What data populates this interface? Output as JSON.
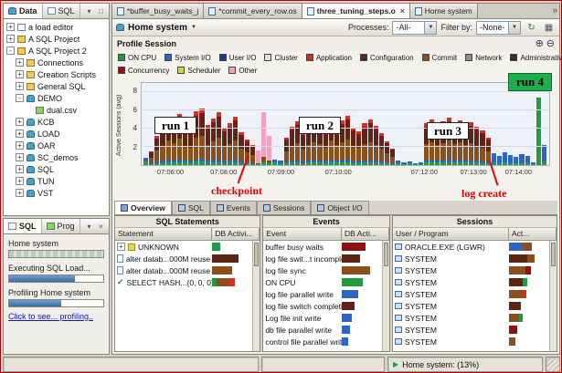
{
  "colors": {
    "cpu": "#1e9c40",
    "sysio": "#2e64c8",
    "usrio": "#123c96",
    "cluster": "#e8e0d0",
    "app": "#cc3322",
    "config": "#5e2414",
    "commit": "#8a4f1d",
    "net": "#8c8c8c",
    "admin": "#303030",
    "conc": "#8d1111",
    "sched": "#ccd444",
    "other": "#f2a0bc"
  },
  "explorer": {
    "tabs": [
      {
        "label": "Data",
        "active": true
      },
      {
        "label": "SQL",
        "active": false
      }
    ],
    "tree": [
      {
        "label": "a load editor",
        "indent": 0,
        "exp": "+",
        "icon": "doc"
      },
      {
        "label": "A SQL Project",
        "indent": 0,
        "exp": "+",
        "icon": "folder"
      },
      {
        "label": "A SQL Project 2",
        "indent": 0,
        "exp": "-",
        "icon": "folder"
      },
      {
        "label": "Connections",
        "indent": 1,
        "exp": "+",
        "icon": "folder"
      },
      {
        "label": "Creation Scripts",
        "indent": 1,
        "exp": "+",
        "icon": "folder"
      },
      {
        "label": "General SQL",
        "indent": 1,
        "exp": "+",
        "icon": "folder"
      },
      {
        "label": "DEMO",
        "indent": 1,
        "exp": "-",
        "icon": "db"
      },
      {
        "label": "dual.csv",
        "indent": 2,
        "exp": null,
        "icon": "csv"
      },
      {
        "label": "KCB",
        "indent": 1,
        "exp": "+",
        "icon": "db"
      },
      {
        "label": "LOAD",
        "indent": 1,
        "exp": "+",
        "icon": "db"
      },
      {
        "label": "OAR",
        "indent": 1,
        "exp": "+",
        "icon": "db"
      },
      {
        "label": "SC_demos",
        "indent": 1,
        "exp": "+",
        "icon": "db"
      },
      {
        "label": "SQL",
        "indent": 1,
        "exp": "+",
        "icon": "db"
      },
      {
        "label": "TUN",
        "indent": 1,
        "exp": "+",
        "icon": "db"
      },
      {
        "label": "VST",
        "indent": 1,
        "exp": "+",
        "icon": "db"
      }
    ]
  },
  "progress": {
    "tabs": [
      {
        "label": "SQL",
        "active": true
      },
      {
        "label": "Prog",
        "active": false
      }
    ],
    "entries": [
      {
        "type": "label",
        "text": "Home system"
      },
      {
        "type": "bar",
        "pct": 100,
        "style": "idle"
      },
      {
        "type": "label",
        "text": "Executing SQL Load..."
      },
      {
        "type": "bar",
        "pct": 70,
        "style": "active"
      },
      {
        "type": "label",
        "text": "Profiling Home system"
      },
      {
        "type": "bar",
        "pct": 55,
        "style": "active"
      },
      {
        "type": "link",
        "text": "Click to see... profiling.."
      }
    ]
  },
  "editor": {
    "tabs": [
      {
        "label": "*buffer_busy_waits_j",
        "active": false
      },
      {
        "label": "*commit_every_row.os",
        "active": false
      },
      {
        "label": "three_tuning_steps.o",
        "active": true
      },
      {
        "label": "Home system",
        "active": false
      }
    ]
  },
  "toolbar": {
    "title": "Home system",
    "processes_label": "Processes:",
    "processes_value": "-All-",
    "filter_label": "Filter by:",
    "filter_value": "-None-"
  },
  "profile": {
    "title": "Profile Session",
    "ylabel": "Active Sessions (avg)"
  },
  "chart_data": {
    "type": "stacked-bar",
    "title": "Profile Session",
    "ylabel": "Active Sessions (avg)",
    "ylim": [
      0,
      9
    ],
    "yticks": [
      8,
      6,
      4,
      2
    ],
    "xticks": [
      {
        "label": "07:06:00",
        "pos": 4
      },
      {
        "label": "07:08:00",
        "pos": 17
      },
      {
        "label": "07:09:00",
        "pos": 31
      },
      {
        "label": "07:10:00",
        "pos": 45
      },
      {
        "label": "07:12:00",
        "pos": 66
      },
      {
        "label": "07:13:00",
        "pos": 78
      },
      {
        "label": "07:14:00",
        "pos": 89
      }
    ],
    "legend_rows": [
      [
        {
          "key": "cpu",
          "label": "ON CPU"
        },
        {
          "key": "sysio",
          "label": "System I/O"
        },
        {
          "key": "usrio",
          "label": "User I/O"
        },
        {
          "key": "cluster",
          "label": "Cluster"
        },
        {
          "key": "app",
          "label": "Application"
        },
        {
          "key": "config",
          "label": "Configuration"
        },
        {
          "key": "commit",
          "label": "Commit"
        },
        {
          "key": "net",
          "label": "Network"
        },
        {
          "key": "admin",
          "label": "Administrative"
        }
      ],
      [
        {
          "key": "conc",
          "label": "Concurrency"
        },
        {
          "key": "sched",
          "label": "Scheduler"
        },
        {
          "key": "other",
          "label": "Other"
        }
      ]
    ],
    "mixes": {
      "r": [
        [
          "cpu",
          0.06
        ],
        [
          "sysio",
          0.05
        ],
        [
          "commit",
          0.4
        ],
        [
          "config",
          0.31
        ],
        [
          "conc",
          0.1
        ],
        [
          "app",
          0.08
        ]
      ],
      "p": [
        [
          "cpu",
          0.05
        ],
        [
          "commit",
          0.1
        ],
        [
          "other",
          0.85
        ]
      ],
      "b": [
        [
          "cpu",
          0.18
        ],
        [
          "sysio",
          0.82
        ]
      ],
      "g": [
        [
          "cpu",
          1.0
        ]
      ],
      "t": [
        [
          "cpu",
          0.5
        ],
        [
          "sysio",
          0.5
        ]
      ]
    },
    "bars": [
      [
        0.8,
        "t"
      ],
      [
        1.5,
        "r"
      ],
      [
        3.2,
        "r"
      ],
      [
        4.1,
        "r"
      ],
      [
        5.2,
        "r"
      ],
      [
        4.8,
        "r"
      ],
      [
        5.6,
        "r"
      ],
      [
        4.2,
        "r"
      ],
      [
        3.8,
        "r"
      ],
      [
        5.9,
        "r"
      ],
      [
        6.2,
        "r"
      ],
      [
        4.4,
        "r"
      ],
      [
        5.1,
        "r"
      ],
      [
        5.8,
        "r"
      ],
      [
        4.0,
        "r"
      ],
      [
        4.6,
        "r"
      ],
      [
        5.3,
        "r"
      ],
      [
        3.6,
        "r"
      ],
      [
        2.8,
        "r"
      ],
      [
        2.2,
        "r"
      ],
      [
        1.6,
        "p"
      ],
      [
        5.8,
        "p"
      ],
      [
        3.2,
        "p"
      ],
      [
        0.6,
        "t"
      ],
      [
        0.5,
        "t"
      ],
      [
        3.0,
        "r"
      ],
      [
        4.2,
        "r"
      ],
      [
        4.8,
        "r"
      ],
      [
        3.6,
        "r"
      ],
      [
        4.4,
        "r"
      ],
      [
        5.0,
        "r"
      ],
      [
        4.6,
        "r"
      ],
      [
        3.8,
        "r"
      ],
      [
        5.2,
        "r"
      ],
      [
        4.4,
        "r"
      ],
      [
        4.9,
        "r"
      ],
      [
        5.4,
        "r"
      ],
      [
        4.1,
        "r"
      ],
      [
        3.7,
        "r"
      ],
      [
        4.6,
        "r"
      ],
      [
        5.0,
        "r"
      ],
      [
        4.3,
        "r"
      ],
      [
        3.5,
        "r"
      ],
      [
        2.6,
        "r"
      ],
      [
        1.8,
        "r"
      ],
      [
        0.5,
        "t"
      ],
      [
        0.3,
        "t"
      ],
      [
        0.4,
        "t"
      ],
      [
        0.2,
        "t"
      ],
      [
        0.3,
        "t"
      ],
      [
        4.6,
        "r"
      ],
      [
        5.0,
        "r"
      ],
      [
        4.4,
        "r"
      ],
      [
        4.8,
        "r"
      ],
      [
        5.2,
        "r"
      ],
      [
        4.5,
        "r"
      ],
      [
        4.9,
        "r"
      ],
      [
        4.3,
        "r"
      ],
      [
        4.7,
        "r"
      ],
      [
        4.2,
        "r"
      ],
      [
        3.8,
        "r"
      ],
      [
        3.0,
        "r"
      ],
      [
        1.3,
        "b"
      ],
      [
        1.0,
        "b"
      ],
      [
        1.4,
        "b"
      ],
      [
        1.1,
        "b"
      ],
      [
        0.9,
        "b"
      ],
      [
        1.2,
        "b"
      ],
      [
        1.0,
        "b"
      ],
      [
        0.3,
        "t"
      ],
      [
        7.4,
        "g"
      ],
      [
        2.2,
        "b"
      ]
    ],
    "annotations": {
      "run1": "run 1",
      "run2": "run 2",
      "run3": "run 3",
      "run4": "run 4",
      "checkpoint": "checkpoint",
      "log_create": "log create"
    }
  },
  "details": {
    "tabs": [
      {
        "label": "Overview",
        "active": true
      },
      {
        "label": "SQL",
        "active": false
      },
      {
        "label": "Events",
        "active": false
      },
      {
        "label": "Sessions",
        "active": false
      },
      {
        "label": "Object I/O",
        "active": false
      }
    ],
    "sql": {
      "title": "SQL Statements",
      "cols": [
        "Statement",
        "DB Activi..."
      ],
      "rows": [
        {
          "label": "UNKNOWN",
          "icon": "unknown",
          "exp": "+",
          "bar": [
            [
              "cpu",
              18
            ]
          ]
        },
        {
          "label": "alter datab...000M reuse",
          "icon": "sqlstmt",
          "exp": null,
          "bar": [
            [
              "config",
              58
            ]
          ]
        },
        {
          "label": "alter datab...000M reuse",
          "icon": "sqlstmt",
          "exp": null,
          "bar": [
            [
              "commit",
              44
            ]
          ]
        },
        {
          "label": "SELECT HASH...{0, 0, 0}",
          "icon": "check",
          "exp": null,
          "bar": [
            [
              "cpu",
              10
            ],
            [
              "commit",
              26
            ],
            [
              "app",
              14
            ]
          ]
        }
      ]
    },
    "events": {
      "title": "Events",
      "cols": [
        "Event",
        "DB Acti..."
      ],
      "rows": [
        {
          "label": "buffer busy waits",
          "bar": [
            [
              "conc",
              52
            ]
          ]
        },
        {
          "label": "log file swit...t incomplete)",
          "bar": [
            [
              "config",
              40
            ]
          ]
        },
        {
          "label": "log file sync",
          "bar": [
            [
              "commit",
              62
            ]
          ]
        },
        {
          "label": "ON CPU",
          "bar": [
            [
              "cpu",
              46
            ]
          ]
        },
        {
          "label": "log file parallel write",
          "bar": [
            [
              "sysio",
              36
            ]
          ]
        },
        {
          "label": "log file switch completion",
          "bar": [
            [
              "config",
              28
            ]
          ]
        },
        {
          "label": "Log file init write",
          "bar": [
            [
              "sysio",
              22
            ]
          ]
        },
        {
          "label": "db file parallel write",
          "bar": [
            [
              "sysio",
              18
            ]
          ]
        },
        {
          "label": "control file parallel write",
          "bar": [
            [
              "sysio",
              14
            ]
          ]
        }
      ]
    },
    "sessions": {
      "title": "Sessions",
      "cols": [
        "User / Program",
        "Act..."
      ],
      "rows": [
        {
          "label": "ORACLE.EXE (LGWR)",
          "bar": [
            [
              "sysio",
              30
            ],
            [
              "commit",
              20
            ]
          ]
        },
        {
          "label": "SYSTEM",
          "bar": [
            [
              "config",
              40
            ],
            [
              "commit",
              15
            ]
          ]
        },
        {
          "label": "SYSTEM",
          "bar": [
            [
              "commit",
              35
            ],
            [
              "conc",
              12
            ]
          ]
        },
        {
          "label": "SYSTEM",
          "bar": [
            [
              "config",
              30
            ],
            [
              "cpu",
              10
            ]
          ]
        },
        {
          "label": "SYSTEM",
          "bar": [
            [
              "commit",
              28
            ],
            [
              "app",
              10
            ]
          ]
        },
        {
          "label": "SYSTEM",
          "bar": [
            [
              "config",
              26
            ]
          ]
        },
        {
          "label": "SYSTEM",
          "bar": [
            [
              "commit",
              22
            ],
            [
              "cpu",
              8
            ]
          ]
        },
        {
          "label": "SYSTEM",
          "bar": [
            [
              "conc",
              18
            ]
          ]
        },
        {
          "label": "SYSTEM",
          "bar": [
            [
              "commit",
              14
            ]
          ]
        }
      ]
    }
  },
  "statusbar": {
    "session": "Home system: (13%)"
  }
}
